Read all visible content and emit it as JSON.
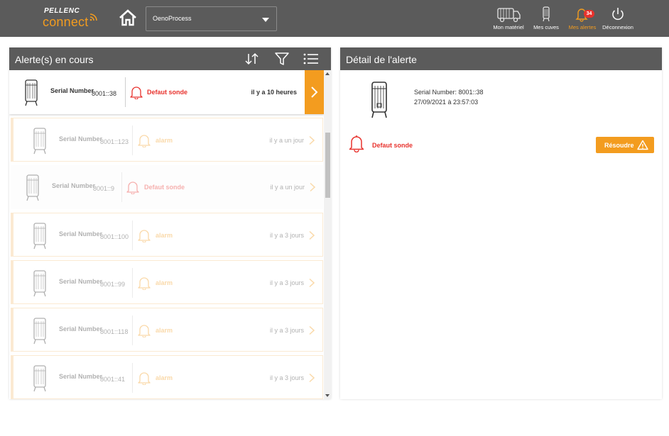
{
  "header": {
    "logo_brand": "PELLENC",
    "logo_product": "connect",
    "site_select": {
      "value": "OenoProcess"
    },
    "nav": [
      {
        "id": "materiel",
        "label": "Mon matériel",
        "icon": "truck-icon"
      },
      {
        "id": "cuves",
        "label": "Mes cuves",
        "icon": "tank-icon"
      },
      {
        "id": "alertes",
        "label": "Mes alertes",
        "icon": "bell-icon",
        "badge": "34",
        "active": true
      },
      {
        "id": "deconnexion",
        "label": "Déconnexion",
        "icon": "power-icon"
      }
    ]
  },
  "list_panel": {
    "title": "Alerte(s) en cours",
    "tools": [
      "sort-icon",
      "filter-icon",
      "list-icon"
    ],
    "sn_label": "Serial Number",
    "items": [
      {
        "sn": "8001::38",
        "alert": "Defaut sonde",
        "time": "il y a 10 heures",
        "state": "selected"
      },
      {
        "sn": "8001::123",
        "alert": "alarm",
        "time": "il y a un jour",
        "state": "pending"
      },
      {
        "sn": "8001::9",
        "alert": "Defaut sonde",
        "time": "il y a un jour",
        "state": "plain"
      },
      {
        "sn": "8001::100",
        "alert": "alarm",
        "time": "il y a 3 jours",
        "state": "pending"
      },
      {
        "sn": "8001::99",
        "alert": "alarm",
        "time": "il y a 3 jours",
        "state": "pending"
      },
      {
        "sn": "8001::118",
        "alert": "alarm",
        "time": "il y a 3 jours",
        "state": "pending"
      },
      {
        "sn": "8001::41",
        "alert": "alarm",
        "time": "il y a 3 jours",
        "state": "pending"
      }
    ]
  },
  "detail_panel": {
    "title": "Détail de l'alerte",
    "serial": "Serial Number: 8001::38",
    "date": "27/09/2021 à 23:57:03",
    "alert": "Defaut sonde",
    "resolve_label": "Résoudre"
  },
  "colors": {
    "accent": "#f39c1f",
    "alert_red": "#e8322d",
    "bar_gray": "#5b5b5b",
    "pending_border": "#f6c98a"
  }
}
